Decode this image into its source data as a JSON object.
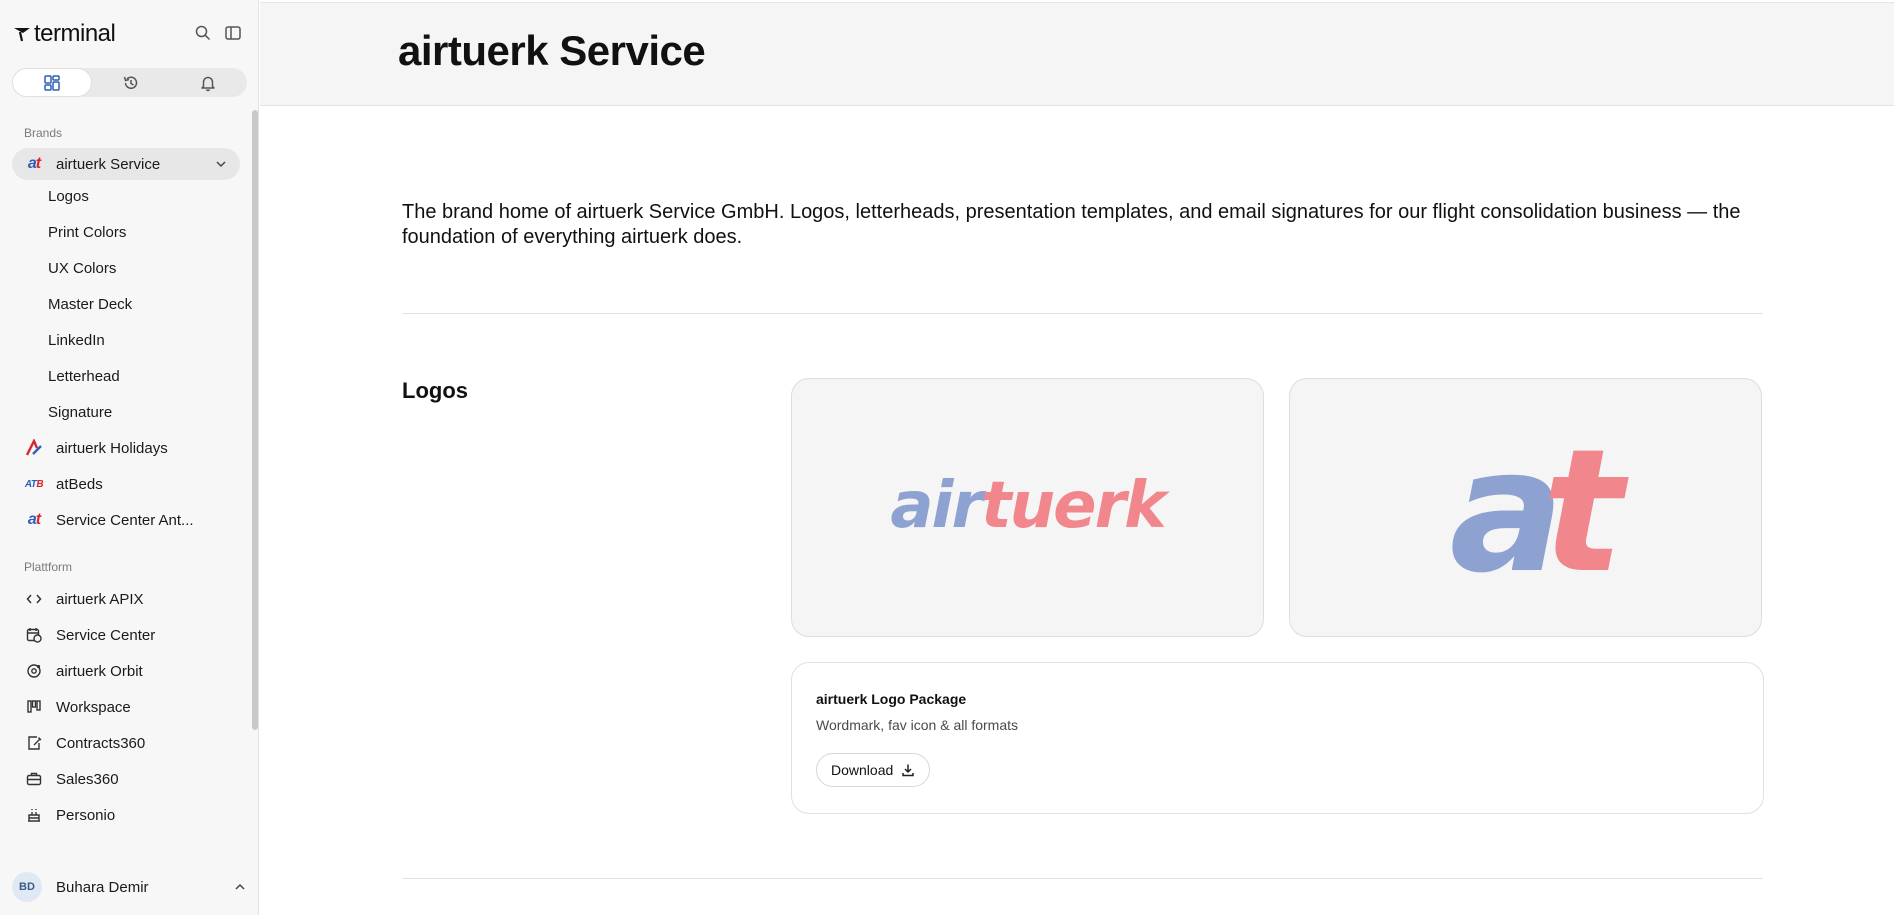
{
  "app": {
    "brand": "terminal"
  },
  "sidebar": {
    "sections": {
      "brands": "Brands",
      "platform": "Plattform"
    },
    "brands": [
      {
        "label": "airtuerk Service",
        "icon": "at-brand-icon",
        "active": true
      },
      {
        "label": "airtuerk Holidays",
        "icon": "airtuerk-holidays-icon"
      },
      {
        "label": "atBeds",
        "icon": "atbeds-icon"
      },
      {
        "label": "Service Center Ant...",
        "icon": "at-brand-icon"
      }
    ],
    "sub_items": [
      "Logos",
      "Print Colors",
      "UX Colors",
      "Master Deck",
      "LinkedIn",
      "Letterhead",
      "Signature"
    ],
    "platform": [
      {
        "label": "airtuerk APIX",
        "icon": "code-icon"
      },
      {
        "label": "Service Center",
        "icon": "calendar-clock-icon"
      },
      {
        "label": "airtuerk Orbit",
        "icon": "orbit-icon"
      },
      {
        "label": "Workspace",
        "icon": "kanban-icon"
      },
      {
        "label": "Contracts360",
        "icon": "contract-icon"
      },
      {
        "label": "Sales360",
        "icon": "briefcase-icon"
      },
      {
        "label": "Personio",
        "icon": "cake-icon"
      }
    ],
    "user": {
      "initials": "BD",
      "name": "Buhara Demir"
    }
  },
  "main": {
    "title": "airtuerk Service",
    "intro": "The brand home of airtuerk Service GmbH. Logos, letterheads, presentation templates, and email signatures for our flight consolidation business — the foundation of everything airtuerk does.",
    "logos_section": {
      "title": "Logos",
      "wordmark": {
        "part1": "air",
        "part2": "tuerk"
      },
      "favicon": {
        "part1": "a",
        "part2": "t"
      },
      "package": {
        "title": "airtuerk Logo Package",
        "subtitle": "Wordmark, fav icon & all formats",
        "download_label": "Download"
      }
    }
  },
  "colors": {
    "brand_blue": "#8ea2d2",
    "brand_pink": "#f1868c",
    "accent_blue": "#2b5fb8",
    "accent_red": "#d8262f"
  }
}
